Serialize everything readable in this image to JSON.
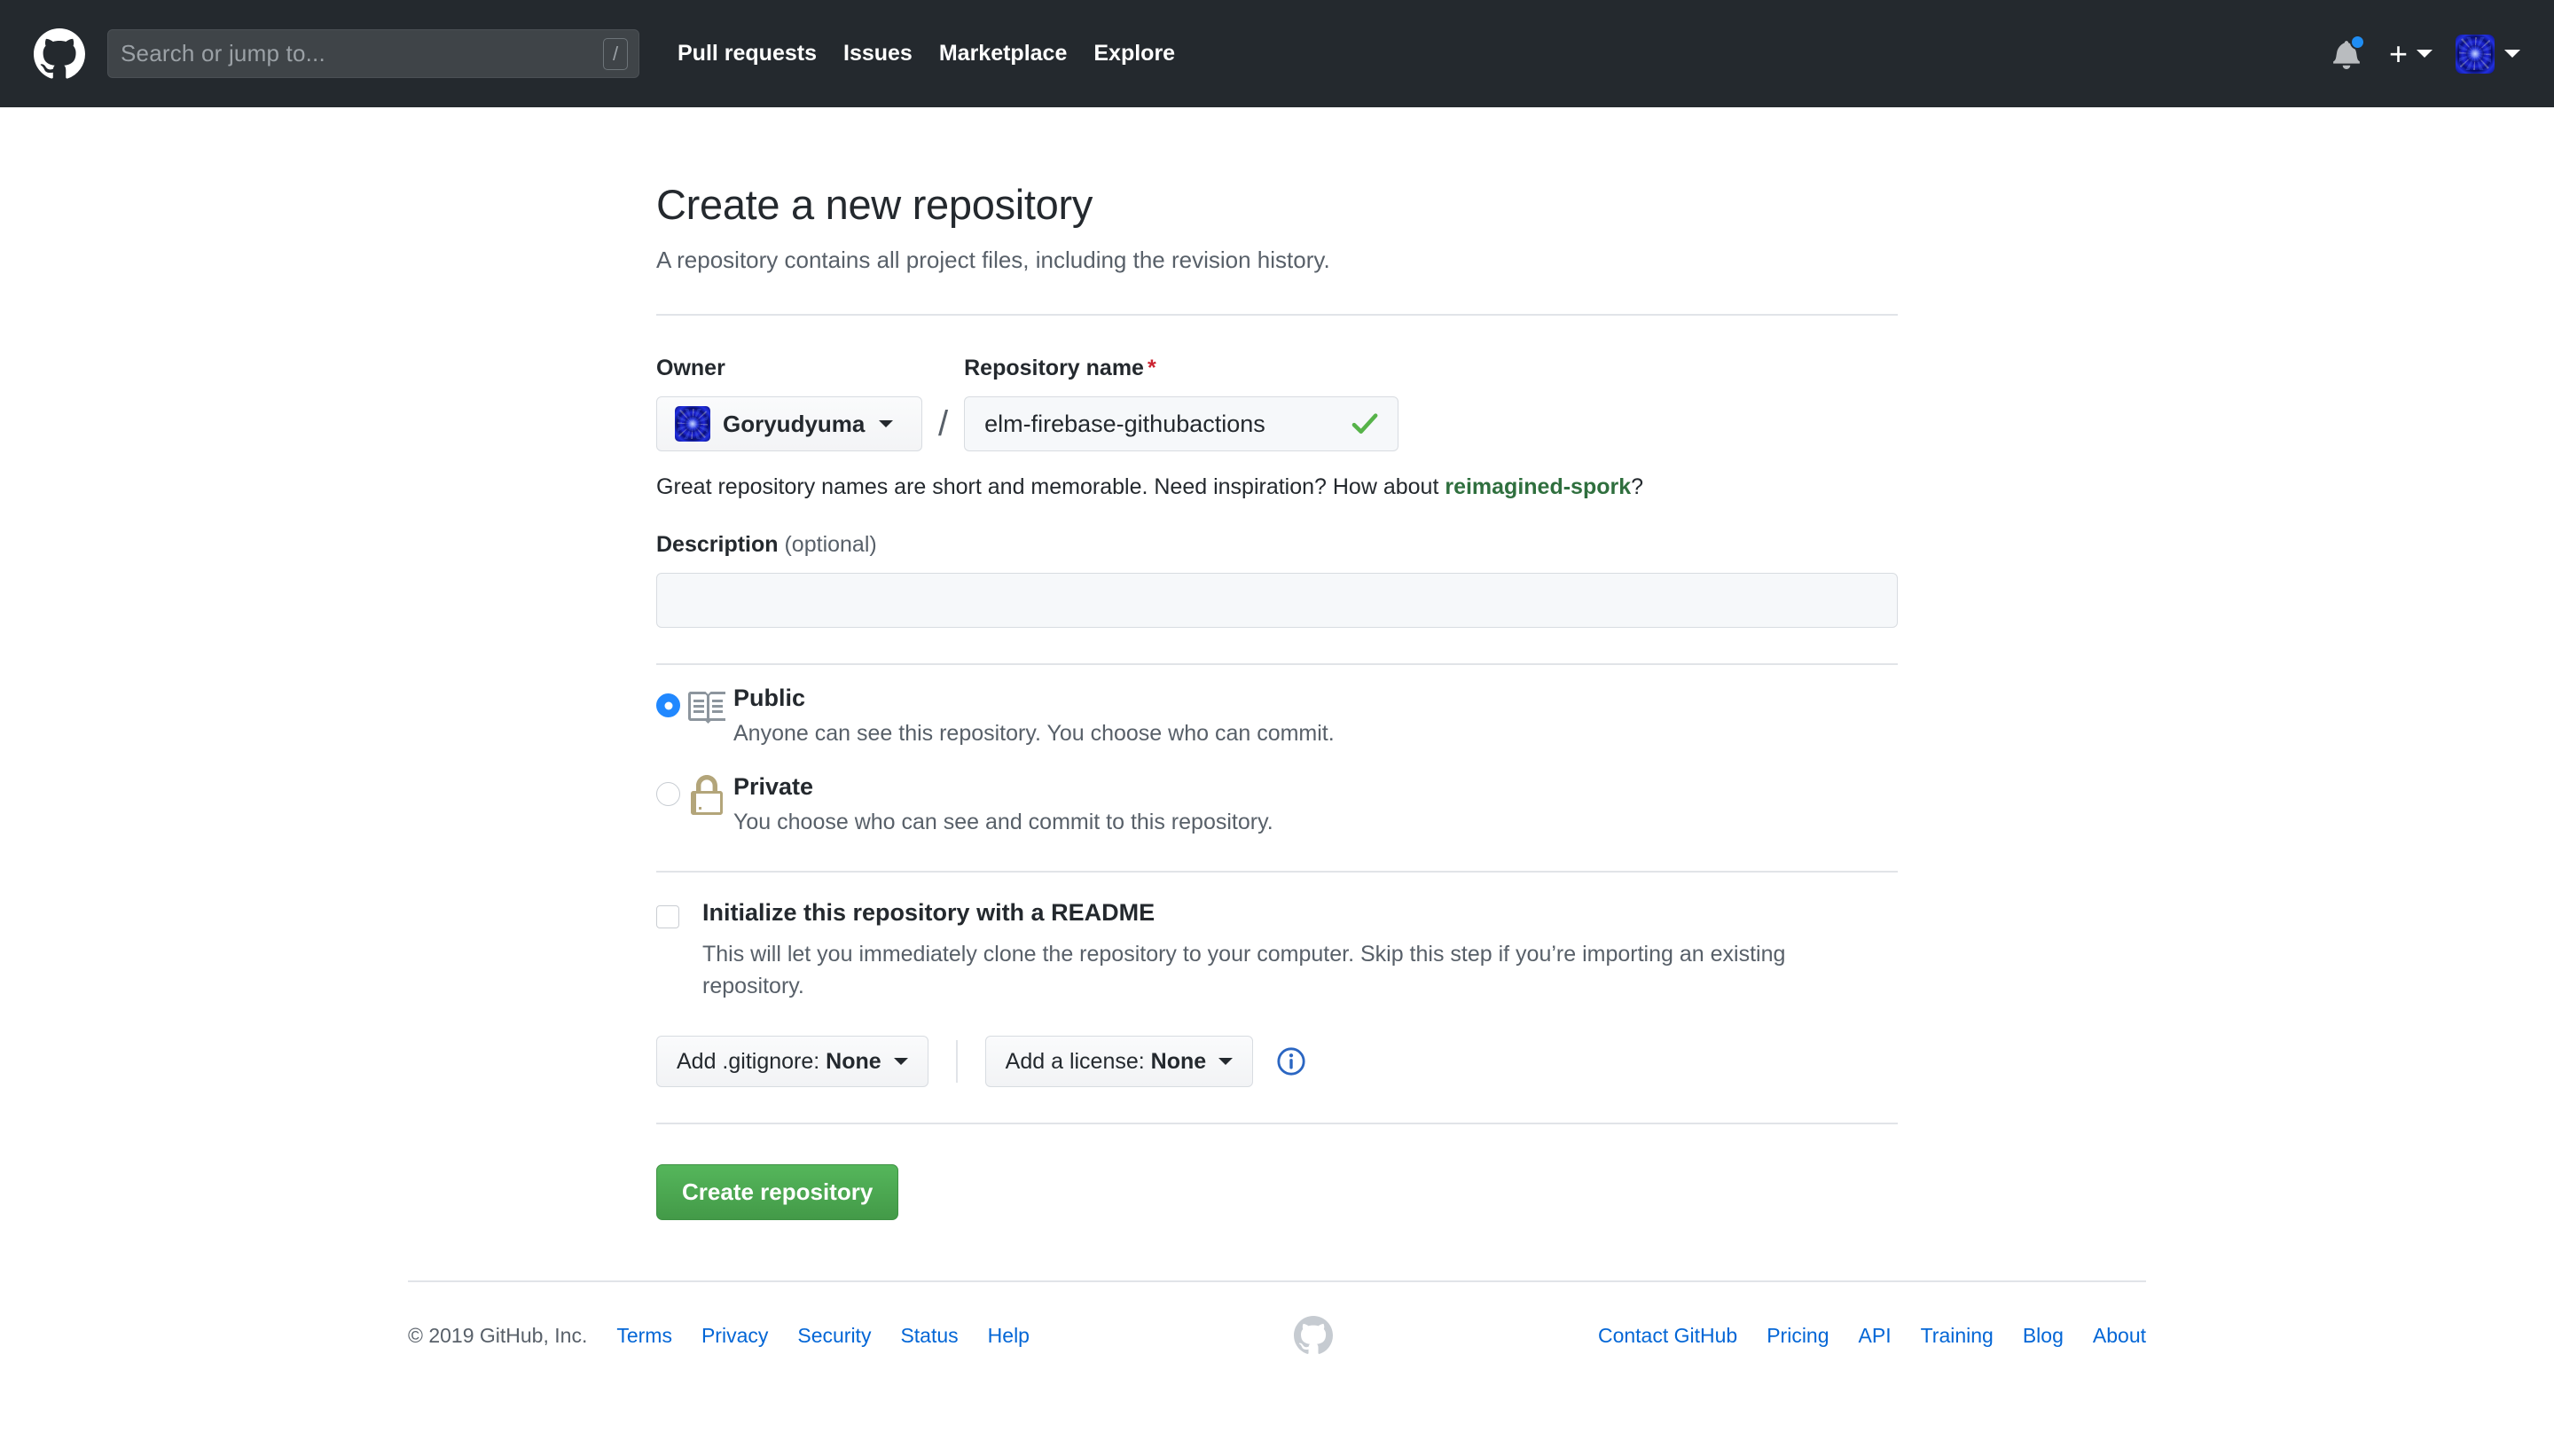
{
  "header": {
    "logo_icon": "github-mark-icon",
    "search": {
      "placeholder": "Search or jump to...",
      "value": "",
      "shortcut_key": "/"
    },
    "nav": [
      {
        "label": "Pull requests"
      },
      {
        "label": "Issues"
      },
      {
        "label": "Marketplace"
      },
      {
        "label": "Explore"
      }
    ],
    "notifications_icon": "bell-icon",
    "has_unread": true,
    "create_new_icon": "plus-icon",
    "profile_icon": "user-avatar"
  },
  "main": {
    "title": "Create a new repository",
    "subtitle": "A repository contains all project files, including the revision history.",
    "owner": {
      "label": "Owner",
      "selected": "Goryudyuma"
    },
    "separator": "/",
    "repository_name": {
      "label": "Repository name",
      "required_marker": "*",
      "value": "elm-firebase-githubactions",
      "valid_icon": "check-icon"
    },
    "hint": {
      "prefix": "Great repository names are short and memorable. Need inspiration? How about ",
      "suggestion": "reimagined-spork",
      "suffix": "?"
    },
    "description": {
      "label": "Description",
      "optional_label": "(optional)",
      "value": "",
      "placeholder": ""
    },
    "visibility": [
      {
        "id": "public",
        "icon": "repo-book-icon",
        "title": "Public",
        "description": "Anyone can see this repository. You choose who can commit.",
        "checked": true
      },
      {
        "id": "private",
        "icon": "lock-icon",
        "title": "Private",
        "description": "You choose who can see and commit to this repository.",
        "checked": false
      }
    ],
    "readme": {
      "checked": false,
      "title": "Initialize this repository with a README",
      "description": "This will let you immediately clone the repository to your computer. Skip this step if you’re importing an existing repository."
    },
    "gitignore": {
      "prefix": "Add .gitignore: ",
      "value": "None"
    },
    "license": {
      "prefix": "Add a license: ",
      "value": "None"
    },
    "info_icon": "info-circle-icon",
    "submit_label": "Create repository"
  },
  "footer": {
    "copyright": "© 2019 GitHub, Inc.",
    "left_links": [
      {
        "label": "Terms"
      },
      {
        "label": "Privacy"
      },
      {
        "label": "Security"
      },
      {
        "label": "Status"
      },
      {
        "label": "Help"
      }
    ],
    "mark_icon": "github-mark-icon",
    "right_links": [
      {
        "label": "Contact GitHub"
      },
      {
        "label": "Pricing"
      },
      {
        "label": "API"
      },
      {
        "label": "Training"
      },
      {
        "label": "Blog"
      },
      {
        "label": "About"
      }
    ]
  },
  "colors": {
    "header_bg": "#24292e",
    "link": "#0366d6",
    "accent_green": "#43a047",
    "suggestion_green": "#2f6f3e",
    "required_red": "#cb2431",
    "radio_blue": "#2188ff",
    "muted_text": "#586069",
    "border": "#e1e4e8"
  }
}
